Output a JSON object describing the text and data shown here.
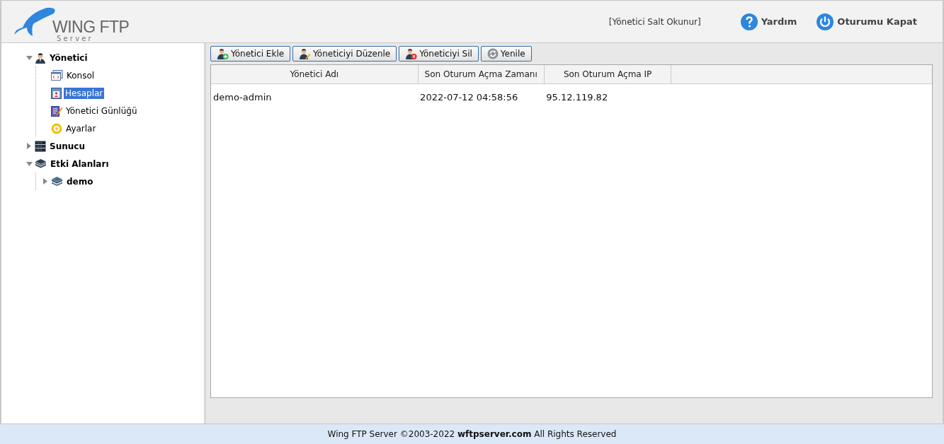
{
  "header": {
    "logo_text": "WING FTP",
    "logo_subtext": "S e r v e r",
    "role_label": "[Yönetici Salt Okunur]",
    "help": "Yardım",
    "logout": "Oturumu Kapat"
  },
  "tree": [
    {
      "label": "Yönetici",
      "kind": "admin",
      "expanded": true,
      "selected": false,
      "children": [
        {
          "label": "Konsol",
          "kind": "console",
          "selected": false
        },
        {
          "label": "Hesaplar",
          "kind": "accounts",
          "selected": true
        },
        {
          "label": "Yönetici Günlüğü",
          "kind": "log",
          "selected": false
        },
        {
          "label": "Ayarlar",
          "kind": "settings",
          "selected": false
        }
      ]
    },
    {
      "label": "Sunucu",
      "kind": "server",
      "expanded": false,
      "selected": false
    },
    {
      "label": "Etki Alanları",
      "kind": "domains",
      "expanded": true,
      "selected": false,
      "children": [
        {
          "label": "demo",
          "kind": "domain",
          "expanded": false,
          "selected": false
        }
      ]
    }
  ],
  "toolbar": [
    {
      "label": "Yönetici Ekle",
      "kind": "add"
    },
    {
      "label": "Yöneticiyi Düzenle",
      "kind": "edit"
    },
    {
      "label": "Yöneticiyi Sil",
      "kind": "delete"
    },
    {
      "label": "Yenile",
      "kind": "refresh"
    }
  ],
  "table": {
    "columns": [
      "Yönetici Adı",
      "Son Oturum Açma Zamanı",
      "Son Oturum Açma IP"
    ],
    "rows": [
      [
        "demo-admin",
        "2022-07-12 04:58:56",
        "95.12.119.82"
      ]
    ]
  },
  "footer": {
    "text_before": "Wing FTP Server ©2003-2022",
    "link": "wftpserver.com",
    "text_after": "All Rights Reserved"
  }
}
